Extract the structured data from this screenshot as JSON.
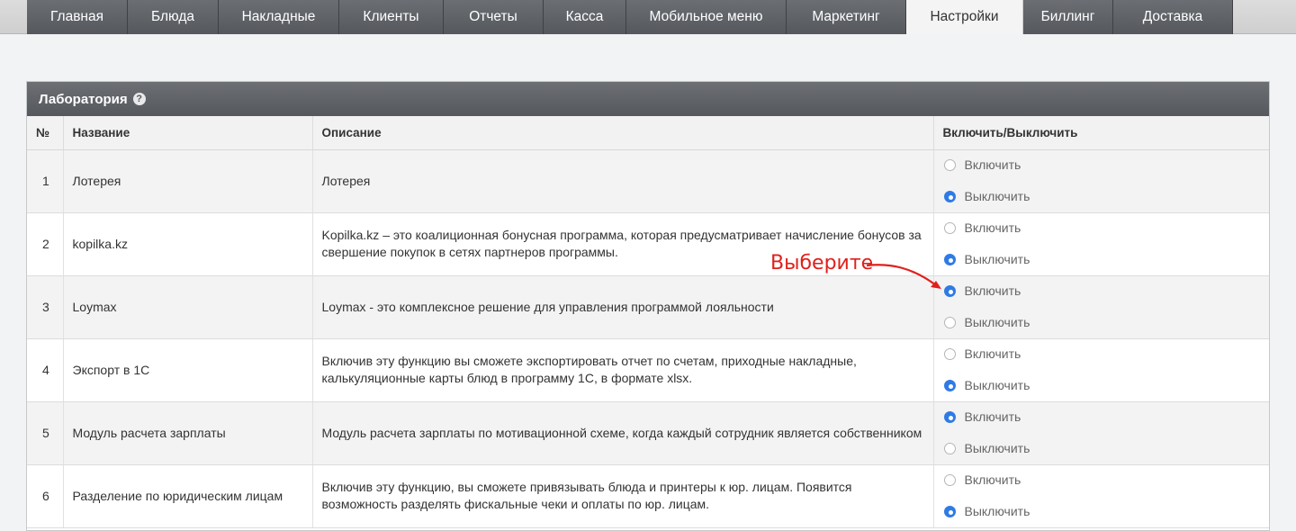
{
  "nav": {
    "tabs": [
      {
        "label": "Главная"
      },
      {
        "label": "Блюда"
      },
      {
        "label": "Накладные"
      },
      {
        "label": "Клиенты"
      },
      {
        "label": "Отчеты"
      },
      {
        "label": "Касса"
      },
      {
        "label": "Мобильное меню"
      },
      {
        "label": "Маркетинг"
      },
      {
        "label": "Настройки",
        "active": true
      },
      {
        "label": "Биллинг"
      },
      {
        "label": "Доставка"
      }
    ]
  },
  "panel": {
    "title": "Лаборатория",
    "help_icon": "question-circle-icon",
    "columns": [
      "№",
      "Название",
      "Описание",
      "Включить/Выключить"
    ],
    "enable_label": "Включить",
    "disable_label": "Выключить",
    "rows": [
      {
        "num": "1",
        "name": "Лотерея",
        "desc": "Лотерея",
        "enabled": false
      },
      {
        "num": "2",
        "name": "kopilka.kz",
        "desc": "Kopilka.kz – это коалиционная бонусная программа, которая предусматривает начисление бонусов за свершение покупок в сетях партнеров программы.",
        "enabled": false
      },
      {
        "num": "3",
        "name": "Loymax",
        "desc": "Loymax - это комплексное решение для управления программой лояльности",
        "enabled": true
      },
      {
        "num": "4",
        "name": "Экспорт в 1С",
        "desc": "Включив эту функцию вы сможете экспортировать отчет по счетам, приходные накладные, калькуляционные карты блюд в программу 1С, в формате xlsx.",
        "enabled": false
      },
      {
        "num": "5",
        "name": "Модуль расчета зарплаты",
        "desc": "Модуль расчета зарплаты по мотивационной схеме, когда каждый сотрудник является собственником",
        "enabled": true
      },
      {
        "num": "6",
        "name": "Разделение по юридическим лицам",
        "desc": "Включив эту функцию, вы сможете привязывать блюда и принтеры к юр. лицам. Появится возможность разделять фискальные чеки и оплаты по юр. лицам.",
        "enabled": false
      }
    ]
  },
  "annotation": {
    "text": "Выберите",
    "color": "#e0201b"
  },
  "colors": {
    "accent": "#2f7be5",
    "header_bg": "#5f6267",
    "annotation": "#e0201b"
  }
}
